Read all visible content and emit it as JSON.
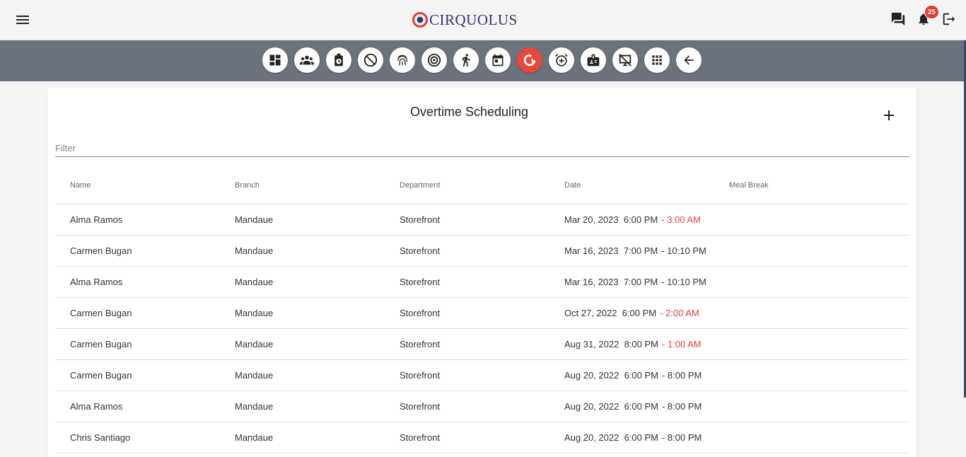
{
  "app": {
    "logo_text": "CIRQUOLUS",
    "notification_count": "25"
  },
  "toolbar": {
    "icons": [
      "dashboard-icon",
      "group-icon",
      "time-icon",
      "blocked-icon",
      "fingerprint-icon",
      "target-icon",
      "run-icon",
      "calendar-icon",
      "overtime-icon",
      "alarm-add-icon",
      "badge-icon",
      "no-display-icon",
      "apps-icon",
      "back-arrow-icon"
    ],
    "active": "overtime-icon"
  },
  "page": {
    "title": "Overtime Scheduling",
    "filter_placeholder": "Filter"
  },
  "table": {
    "headers": [
      "Name",
      "Branch",
      "Department",
      "Date",
      "Meal Break"
    ],
    "rows": [
      {
        "name": "Alma Ramos",
        "branch": "Mandaue",
        "department": "Storefront",
        "start": "Mar 20, 2023  6:00 PM",
        "end": "- 3:00 AM",
        "late": true,
        "meal_break": ""
      },
      {
        "name": "Carmen Bugan",
        "branch": "Mandaue",
        "department": "Storefront",
        "start": "Mar 16, 2023  7:00 PM",
        "end": "- 10:10 PM",
        "late": false,
        "meal_break": ""
      },
      {
        "name": "Alma Ramos",
        "branch": "Mandaue",
        "department": "Storefront",
        "start": "Mar 16, 2023  7:00 PM",
        "end": "- 10:10 PM",
        "late": false,
        "meal_break": ""
      },
      {
        "name": "Carmen Bugan",
        "branch": "Mandaue",
        "department": "Storefront",
        "start": "Oct 27, 2022  6:00 PM",
        "end": "- 2:00 AM",
        "late": true,
        "meal_break": ""
      },
      {
        "name": "Carmen Bugan",
        "branch": "Mandaue",
        "department": "Storefront",
        "start": "Aug 31, 2022  8:00 PM",
        "end": "- 1:00 AM",
        "late": true,
        "meal_break": ""
      },
      {
        "name": "Carmen Bugan",
        "branch": "Mandaue",
        "department": "Storefront",
        "start": "Aug 20, 2022  6:00 PM",
        "end": "- 8:00 PM",
        "late": false,
        "meal_break": ""
      },
      {
        "name": "Alma Ramos",
        "branch": "Mandaue",
        "department": "Storefront",
        "start": "Aug 20, 2022  6:00 PM",
        "end": "- 8:00 PM",
        "late": false,
        "meal_break": ""
      },
      {
        "name": "Chris Santiago",
        "branch": "Mandaue",
        "department": "Storefront",
        "start": "Aug 20, 2022  6:00 PM",
        "end": "- 8:00 PM",
        "late": false,
        "meal_break": ""
      }
    ]
  },
  "colors": {
    "toolbar_bg": "#6a737d",
    "active_tool": "#e9463c",
    "late_end_time": "#d9473b",
    "badge": "#e53935",
    "logo": "#2e3a78"
  }
}
